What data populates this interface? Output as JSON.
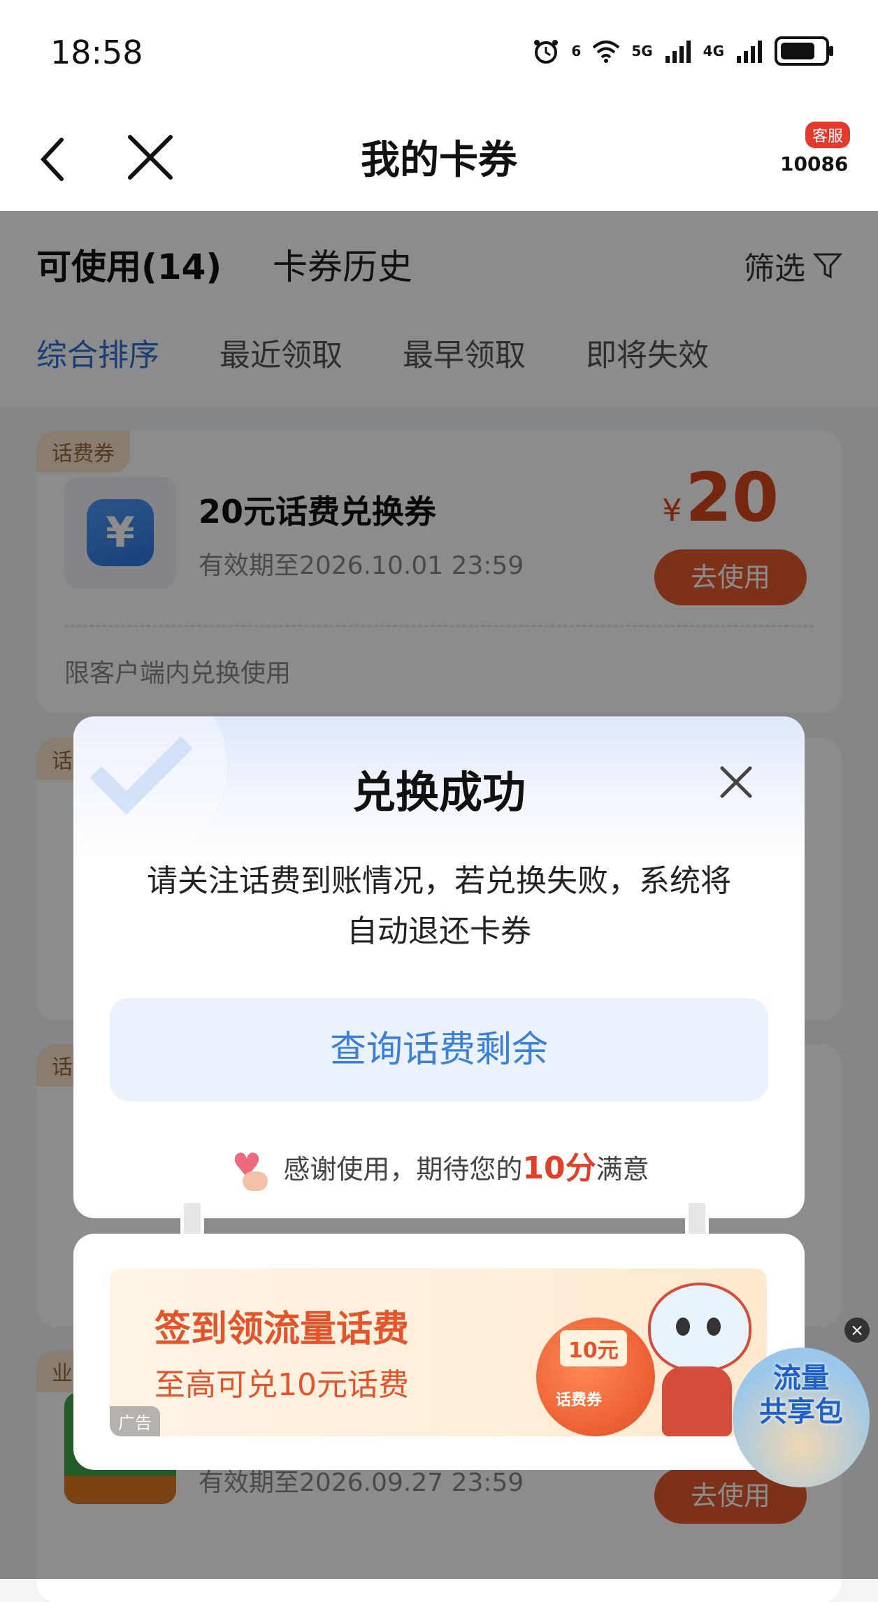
{
  "status_bar": {
    "time": "18:58",
    "net_1": "6",
    "net_2": "5G",
    "net_3": "4G"
  },
  "nav": {
    "title": "我的卡券",
    "service_badge": "客服",
    "service_number": "10086"
  },
  "tabs": {
    "available": "可使用(14)",
    "history": "卡券历史",
    "filter": "筛选"
  },
  "sort": {
    "items": [
      "综合排序",
      "最近领取",
      "最早领取",
      "即将失效"
    ],
    "active_index": 0
  },
  "cards": [
    {
      "tag": "话费券",
      "title": "20元话费兑换券",
      "expiry": "有效期至2026.10.01 23:59",
      "price_symbol": "¥",
      "price": "20",
      "button": "去使用",
      "note": "限客户端内兑换使用"
    },
    {
      "tag": "话"
    },
    {
      "tag": "话"
    },
    {
      "tag": "业",
      "expiry": "有效期至2026.09.27 23:59",
      "button": "去使用"
    }
  ],
  "dialog": {
    "title": "兑换成功",
    "message": "请关注话费到账情况，若兑换失败，系统将自动退还卡券",
    "button": "查询话费剩余",
    "thanks_prefix": "感谢使用，期待您的",
    "thanks_score": "10分",
    "thanks_suffix": "满意"
  },
  "ad": {
    "title": "签到领流量话费",
    "subtitle": "至高可兑10元话费",
    "tag": "广告",
    "coupon": "10元",
    "bag_label": "话费券"
  },
  "floating_ad": {
    "text_line1": "流量",
    "text_line2": "共享包",
    "close": "×"
  },
  "colors": {
    "accent_blue": "#2e6fd8",
    "price_red": "#d8481d",
    "use_button": "#e35a2e"
  }
}
